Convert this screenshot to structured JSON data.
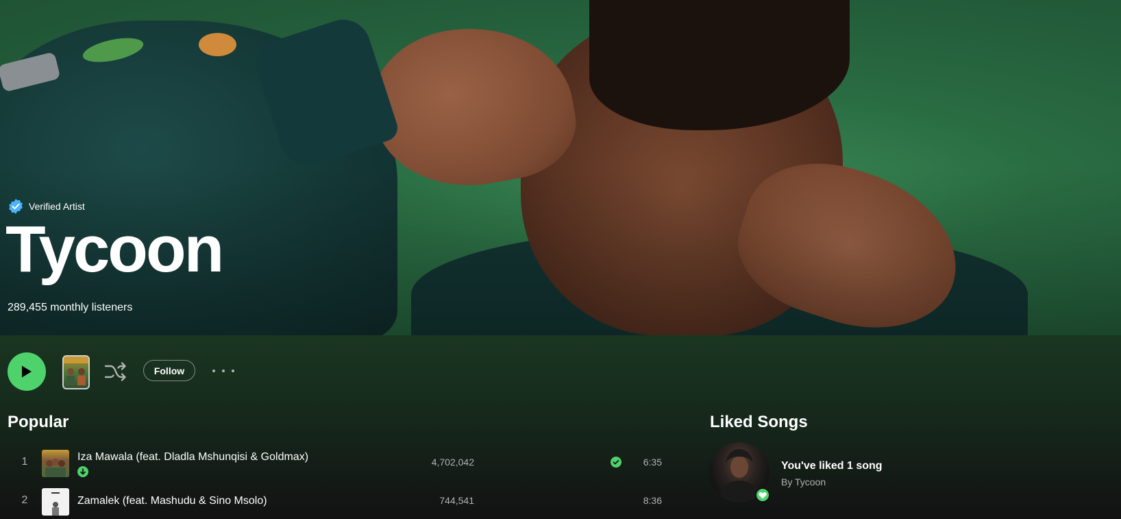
{
  "artist": {
    "verified_label": "Verified Artist",
    "name": "Tycoon",
    "monthly_listeners": "289,455 monthly listeners"
  },
  "actions": {
    "follow_label": "Follow"
  },
  "popular": {
    "heading": "Popular",
    "tracks": [
      {
        "rank": "1",
        "title": "Iza Mawala (feat. Dladla Mshunqisi & Goldmax)",
        "plays": "4,702,042",
        "duration": "6:35",
        "downloaded": true,
        "liked": true
      },
      {
        "rank": "2",
        "title": "Zamalek (feat. Mashudu & Sino Msolo)",
        "plays": "744,541",
        "duration": "8:36",
        "downloaded": false,
        "liked": false
      }
    ]
  },
  "liked_songs": {
    "heading": "Liked Songs",
    "title": "You've liked 1 song",
    "subtitle": "By Tycoon"
  },
  "colors": {
    "accent": "#4ed26b",
    "verified_badge": "#4cb3ff",
    "background": "#121212"
  }
}
